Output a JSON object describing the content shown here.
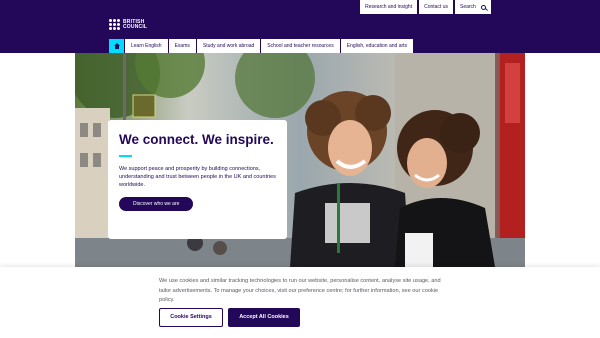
{
  "header": {
    "logo_line1": "BRITISH",
    "logo_line2": "COUNCIL",
    "utility_links": [
      "Research and insight",
      "Contact us",
      "Search"
    ],
    "nav": [
      "Learn English",
      "Exams",
      "Study and work abroad",
      "School and teacher resources",
      "English, education and arts"
    ]
  },
  "hero": {
    "title": "We connect. We inspire.",
    "text": "We support peace and prosperity by building connections, understanding and trust between people in the UK and countries worldwide.",
    "button": "Discover who we are"
  },
  "cookie_banner": {
    "text": "We use cookies and similar tracking technologies to run our website, personalise content, analyse site usage, and tailor advertisements. To manage your choices, visit our preference centre; for further information, see our cookie policy.",
    "settings_button": "Cookie Settings",
    "accept_button": "Accept All Cookies"
  },
  "colors": {
    "brand_purple": "#23085a",
    "accent_cyan": "#00dcff"
  }
}
